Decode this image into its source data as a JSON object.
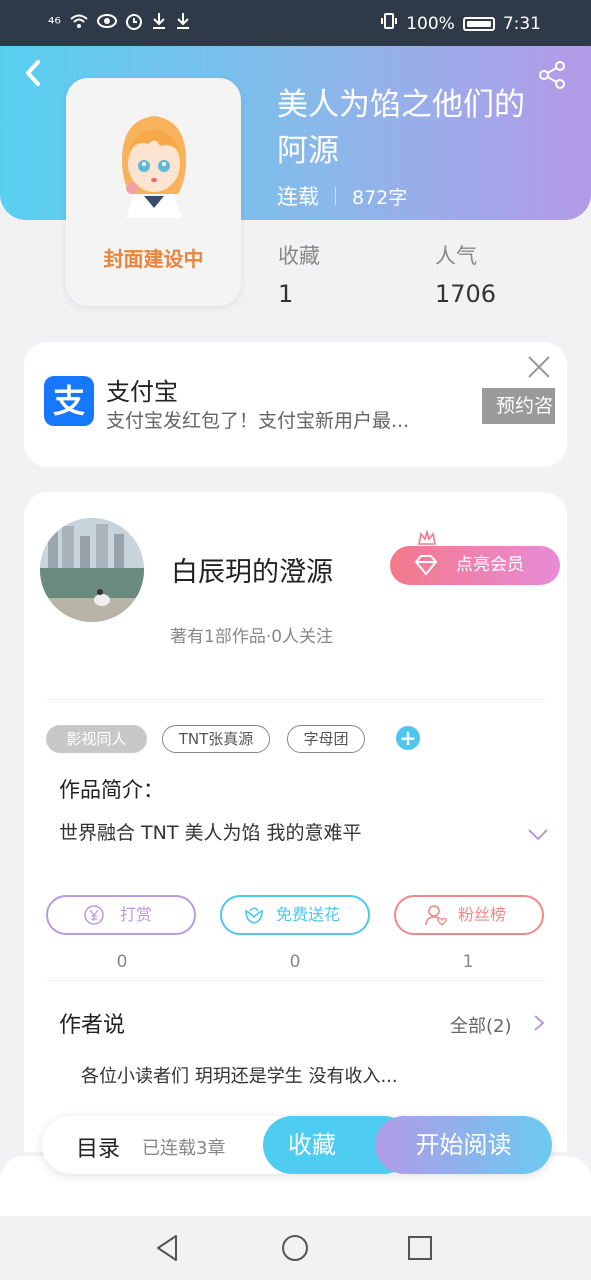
{
  "status_bar": {
    "network": "⁴⁶",
    "battery_percent": "100%",
    "time": "7:31"
  },
  "book": {
    "title": "美人为馅之他们的阿源",
    "status": "连载",
    "word_count": "872字",
    "cover_placeholder": "封面建设中",
    "stats": [
      {
        "label": "收藏",
        "value": "1"
      },
      {
        "label": "人气",
        "value": "1706"
      }
    ]
  },
  "ad": {
    "app_name": "支付宝",
    "logo_glyph": "支",
    "description": "支付宝发红包了！支付宝新用户最...",
    "button_label": "预约咨"
  },
  "author": {
    "name": "白辰玥的澄源",
    "vip_label": "点亮会员",
    "meta": "著有1部作品·0人关注"
  },
  "tags": [
    "影视同人",
    "TNT张真源",
    "字母团"
  ],
  "intro": {
    "label": "作品简介：",
    "text": "世界融合  TNT  美人为馅  我的意难平"
  },
  "actions": [
    {
      "label": "打赏",
      "count": "0",
      "color": "#b89ae2"
    },
    {
      "label": "免费送花",
      "count": "0",
      "color": "#4fc6ee"
    },
    {
      "label": "粉丝榜",
      "count": "1",
      "color": "#ee8a8a"
    }
  ],
  "author_say": {
    "label": "作者说",
    "all_label": "全部(2)",
    "text": "各位小读者们  玥玥还是学生  没有收入..."
  },
  "bottom_bar": {
    "toc_label": "目录",
    "toc_count": "已连载3章",
    "collect_label": "收藏",
    "read_label": "开始阅读"
  },
  "colors": {
    "header_gradient_start": "#57d0f0",
    "header_gradient_end": "#b49ae8",
    "accent_blue": "#4fcdf0",
    "vip_pink": "#f27a8a",
    "cover_text_orange": "#e8853a"
  },
  "icons": [
    "back-arrow-icon",
    "share-icon",
    "close-icon",
    "crown-icon",
    "diamond-icon",
    "plus-icon",
    "chevron-down-icon",
    "chevron-right-icon",
    "yuan-icon",
    "flower-icon",
    "fans-icon",
    "nav-back-icon",
    "nav-home-icon",
    "nav-recent-icon"
  ]
}
